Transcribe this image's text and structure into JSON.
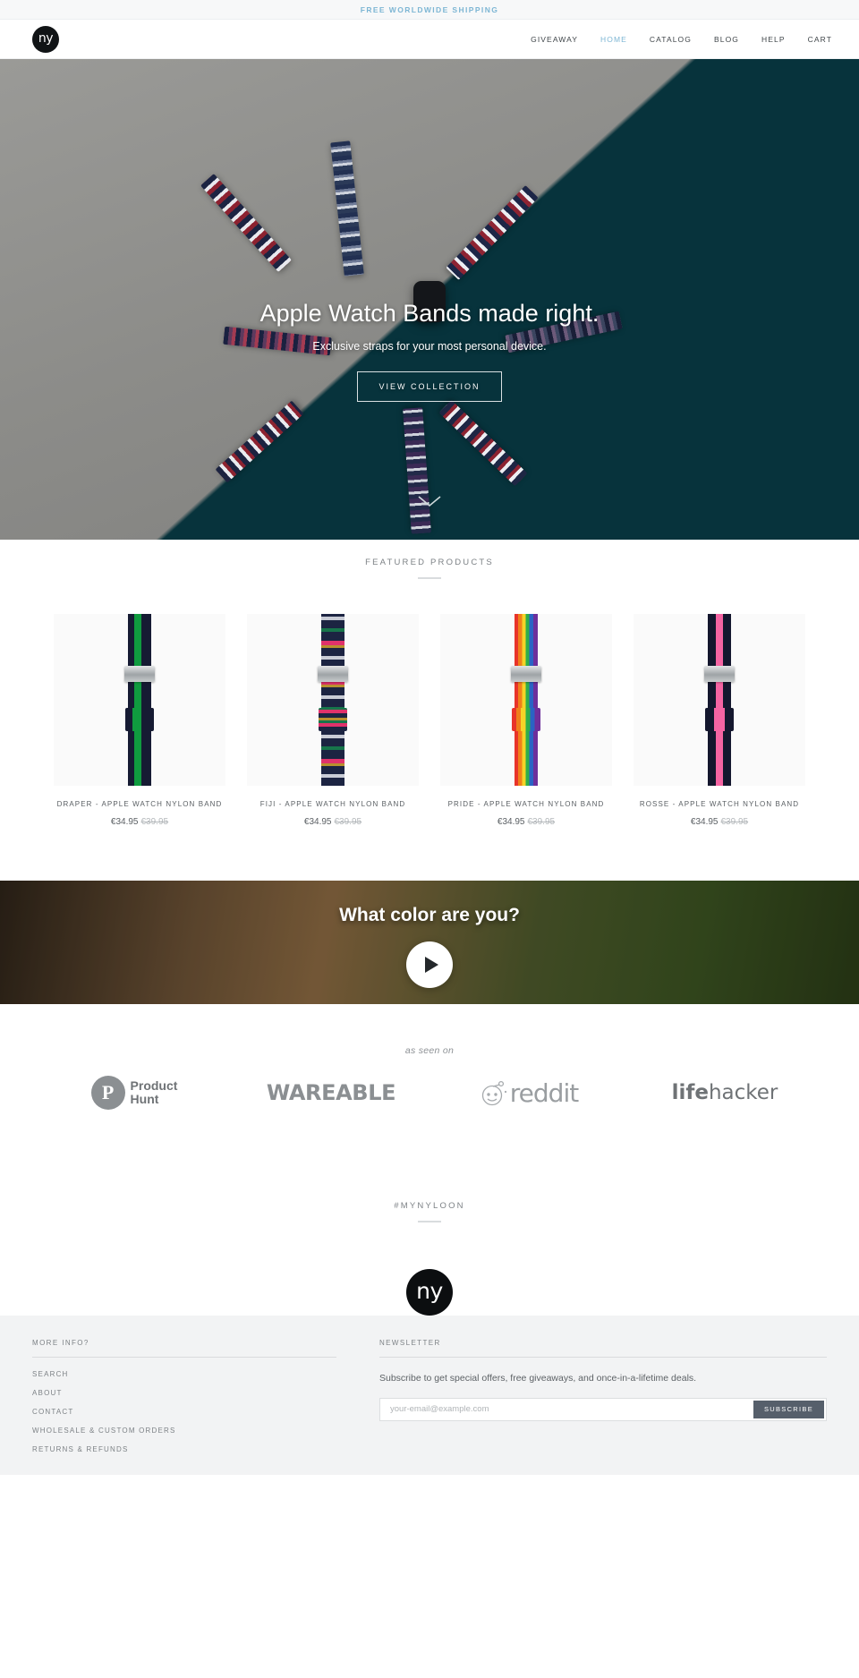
{
  "announcement": {
    "text": "FREE WORLDWIDE SHIPPING",
    "color": "#7db6d4"
  },
  "header": {
    "logo_glyph": "ny",
    "logo_name": "ny",
    "nav": [
      {
        "label": "GIVEAWAY",
        "active": false
      },
      {
        "label": "HOME",
        "active": true
      },
      {
        "label": "CATALOG",
        "active": false
      },
      {
        "label": "BLOG",
        "active": false
      },
      {
        "label": "HELP",
        "active": false
      },
      {
        "label": "CART",
        "active": false
      }
    ]
  },
  "hero": {
    "title": "Apple Watch Bands made right.",
    "subtitle": "Exclusive straps for your most personal device.",
    "cta": "VIEW COLLECTION",
    "scroll_icon": "chevron-down-icon"
  },
  "featured": {
    "title": "FEATURED PRODUCTS",
    "products": [
      {
        "name": "DRAPER - APPLE WATCH NYLON BAND",
        "price": "€34.95",
        "compare_price": "€39.95"
      },
      {
        "name": "FIJI - APPLE WATCH NYLON BAND",
        "price": "€34.95",
        "compare_price": "€39.95"
      },
      {
        "name": "PRIDE - APPLE WATCH NYLON BAND",
        "price": "€34.95",
        "compare_price": "€39.95"
      },
      {
        "name": "ROSSE - APPLE WATCH NYLON BAND",
        "price": "€34.95",
        "compare_price": "€39.95"
      }
    ]
  },
  "video": {
    "title": "What color are you?",
    "play_icon": "play-icon"
  },
  "press": {
    "label": "as seen on",
    "logos": [
      {
        "name": "Product Hunt",
        "mark": "P",
        "line1": "Product",
        "line2": "Hunt"
      },
      {
        "name": "WAREABLE",
        "text": "WAREABLE"
      },
      {
        "name": "reddit",
        "text": "reddit"
      },
      {
        "name": "lifehacker",
        "bold": "life",
        "rest": "hacker"
      }
    ]
  },
  "hashtag": {
    "text": "#MYNYLOON"
  },
  "footer": {
    "logo_glyph": "ny",
    "more_info": {
      "heading": "MORE INFO?",
      "links": [
        "SEARCH",
        "ABOUT",
        "CONTACT",
        "WHOLESALE & CUSTOM ORDERS",
        "RETURNS & REFUNDS"
      ]
    },
    "newsletter": {
      "heading": "NEWSLETTER",
      "description": "Subscribe to get special offers, free giveaways, and once-in-a-lifetime deals.",
      "placeholder": "your-email@example.com",
      "value": "",
      "button": "SUBSCRIBE"
    }
  }
}
